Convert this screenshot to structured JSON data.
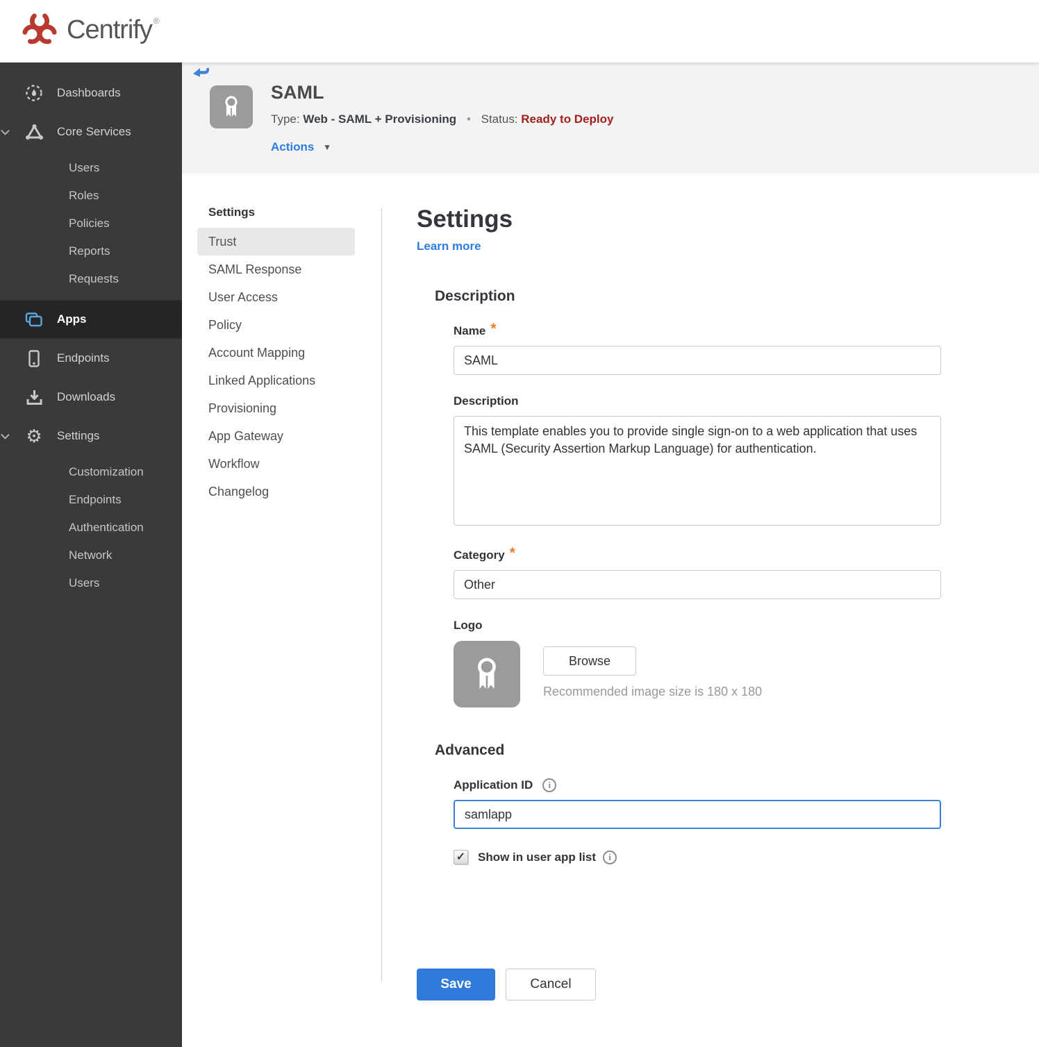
{
  "brand": {
    "name": "Centrify",
    "registered": "®"
  },
  "icons": {
    "caret_down": "▼",
    "check": "✓",
    "info": "i",
    "required": "*",
    "separator": "•"
  },
  "colors": {
    "accent_blue": "#2d7ce0",
    "save_blue": "#2e7bd9",
    "status_red": "#9e211d",
    "asterisk_orange": "#e87e2e",
    "apps_icon_blue": "#54a7e0",
    "brand_red": "#b73a31",
    "sidebar_bg": "#3a3a3a",
    "selected_item_bg": "#e9e9e9"
  },
  "sidebar": {
    "items": [
      {
        "label": "Dashboards",
        "icon": "dashboard-icon"
      },
      {
        "label": "Core Services",
        "icon": "core-services-icon",
        "expanded": true,
        "children": [
          "Users",
          "Roles",
          "Policies",
          "Reports",
          "Requests"
        ]
      },
      {
        "label": "Apps",
        "icon": "apps-icon",
        "active": true
      },
      {
        "label": "Endpoints",
        "icon": "endpoints-icon"
      },
      {
        "label": "Downloads",
        "icon": "downloads-icon"
      },
      {
        "label": "Settings",
        "icon": "settings-gear-icon",
        "expanded": true,
        "children": [
          "Customization",
          "Endpoints",
          "Authentication",
          "Network",
          "Users"
        ]
      }
    ]
  },
  "header": {
    "app_title": "SAML",
    "type_label": "Type:",
    "type_value": "Web - SAML + Provisioning",
    "status_label": "Status:",
    "status_value": "Ready to Deploy",
    "actions_label": "Actions"
  },
  "subnav": {
    "heading": "Settings",
    "selected": "Trust",
    "items": [
      "Trust",
      "SAML Response",
      "User Access",
      "Policy",
      "Account Mapping",
      "Linked Applications",
      "Provisioning",
      "App Gateway",
      "Workflow",
      "Changelog"
    ]
  },
  "content": {
    "title": "Settings",
    "learn_more_label": "Learn more",
    "description_section": {
      "heading": "Description",
      "name_label": "Name",
      "name_value": "SAML",
      "description_label": "Description",
      "description_value": "This template enables you to provide single sign-on to a web application that uses SAML (Security Assertion Markup Language) for authentication.",
      "category_label": "Category",
      "category_value": "Other",
      "logo_label": "Logo",
      "browse_label": "Browse",
      "logo_hint": "Recommended image size is 180 x 180"
    },
    "advanced_section": {
      "heading": "Advanced",
      "application_id_label": "Application ID",
      "application_id_value": "samlapp",
      "show_in_user_app_list_label": "Show in user app list",
      "checkbox_checked": true
    },
    "save_label": "Save",
    "cancel_label": "Cancel"
  }
}
